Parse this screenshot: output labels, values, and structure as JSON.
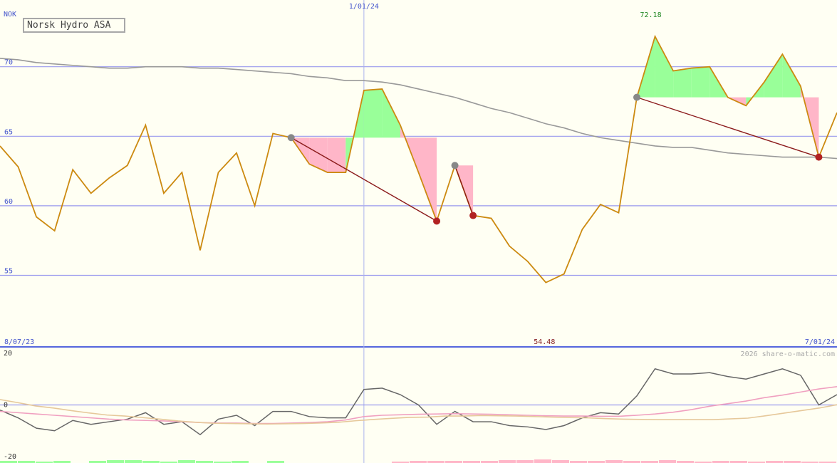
{
  "chart_data": [
    {
      "type": "line",
      "title": "Norsk Hydro ASA",
      "ylabel": "NOK",
      "ylim": [
        49.8,
        74.8
      ],
      "y_ticks": [
        55,
        60,
        65,
        70
      ],
      "x_labels": [
        "8/07/23",
        "1/01/24",
        "7/01/24"
      ],
      "max_label": "72.18",
      "min_label": "54.48",
      "colors": {
        "price": "#cc8a10",
        "ma": "#999999",
        "trend": "#8b1a1a",
        "grid": "#9999ee",
        "up": "#99ff99",
        "down": "#ffb6c8"
      },
      "series": [
        {
          "values": [
            64.3,
            62.8,
            59.2,
            58.2,
            62.6,
            60.9,
            62.0,
            62.9,
            65.8,
            60.9,
            62.4,
            56.8,
            62.4,
            63.8,
            60.0,
            65.2,
            64.9,
            63.0,
            62.4,
            62.4,
            68.3,
            68.4,
            65.8,
            62.4,
            58.9,
            62.9,
            59.3,
            59.1,
            57.1,
            56.0,
            54.48,
            55.1,
            58.3,
            60.1,
            59.5,
            67.8,
            72.18,
            69.7,
            69.9,
            70.0,
            67.8,
            67.2,
            68.9,
            70.9,
            68.6,
            63.5,
            66.7
          ]
        },
        {
          "values": [
            70.6,
            70.5,
            70.3,
            70.2,
            70.1,
            70.0,
            69.9,
            69.9,
            70.0,
            70.0,
            70.0,
            69.9,
            69.9,
            69.8,
            69.7,
            69.6,
            69.5,
            69.3,
            69.2,
            69.0,
            69.0,
            68.9,
            68.7,
            68.4,
            68.1,
            67.8,
            67.4,
            67.0,
            66.7,
            66.3,
            65.9,
            65.6,
            65.2,
            64.9,
            64.7,
            64.5,
            64.3,
            64.2,
            64.2,
            64.0,
            63.8,
            63.7,
            63.6,
            63.5,
            63.5,
            63.5,
            63.4
          ]
        }
      ],
      "signals": [
        {
          "start_index": 16,
          "start_value": 64.9,
          "end_index": 24,
          "end_value": 58.9
        },
        {
          "start_index": 25,
          "start_value": 62.9,
          "end_index": 26,
          "end_value": 59.3
        },
        {
          "start_index": 35,
          "start_value": 67.8,
          "end_index": 45,
          "end_value": 63.5
        }
      ]
    },
    {
      "type": "line",
      "ylim": [
        -20,
        20
      ],
      "y_ticks": [
        20,
        0,
        -20
      ],
      "y_tick_labels": [
        "20",
        "0",
        "-20"
      ],
      "watermark": "2026 share-o-matic.com",
      "series": [
        {
          "values": [
            -2,
            -5,
            -9,
            -10,
            -6,
            -7.5,
            -6.5,
            -5.5,
            -3,
            -7.5,
            -6.5,
            -11.5,
            -5.5,
            -4,
            -8,
            -2.5,
            -2.5,
            -4.5,
            -5,
            -5,
            6,
            6.5,
            4,
            0,
            -7.5,
            -2.5,
            -6.5,
            -6.5,
            -8,
            -8.5,
            -9.5,
            -8,
            -5,
            -3,
            -3.5,
            3.5,
            14,
            12,
            12,
            12.5,
            11,
            10,
            12,
            14,
            11.5,
            0,
            4
          ]
        },
        {
          "values": [
            -2.5,
            -3,
            -3.5,
            -4,
            -4.5,
            -5,
            -5.5,
            -5.8,
            -6,
            -6.2,
            -6.5,
            -6.8,
            -7,
            -7,
            -7.2,
            -7.2,
            -7,
            -6.8,
            -6.5,
            -5.8,
            -4.5,
            -4,
            -3.8,
            -3.6,
            -3.5,
            -3.4,
            -3.5,
            -3.6,
            -3.8,
            -4,
            -4.2,
            -4.3,
            -4.3,
            -4.4,
            -4.4,
            -4,
            -3.5,
            -2.8,
            -1.8,
            -0.5,
            0.5,
            1.5,
            2.8,
            3.8,
            5,
            6.2,
            7.1
          ]
        },
        {
          "values": [
            2.1,
            0.9,
            -0.4,
            -1.2,
            -2.2,
            -3.1,
            -3.9,
            -4.3,
            -4.9,
            -5.5,
            -6.2,
            -6.7,
            -7.1,
            -7.2,
            -7.3,
            -7.4,
            -7.3,
            -7.2,
            -7.0,
            -6.7,
            -6.1,
            -5.6,
            -5.2,
            -4.8,
            -4.7,
            -4.3,
            -4.3,
            -4.1,
            -4.2,
            -4.3,
            -4.5,
            -4.7,
            -4.9,
            -5.0,
            -5.3,
            -5.5,
            -5.6,
            -5.7,
            -5.7,
            -5.7,
            -5.7,
            -5.4,
            -5.1,
            -4.2,
            -3.2,
            -2.2,
            -1.2,
            0.1
          ]
        }
      ],
      "histogram": [
        3,
        3,
        2,
        3,
        0,
        3,
        4,
        4,
        3,
        2,
        4,
        3,
        2,
        3,
        0,
        3,
        0,
        0,
        0,
        0,
        0,
        0,
        -2,
        -3,
        -3,
        -3,
        -3,
        -3,
        -4,
        -4,
        -5,
        -4,
        -3,
        -3,
        -4,
        -3,
        -3,
        -4,
        -3,
        -2,
        -3,
        -3,
        -2,
        -3,
        -3,
        -2,
        -2
      ]
    }
  ]
}
